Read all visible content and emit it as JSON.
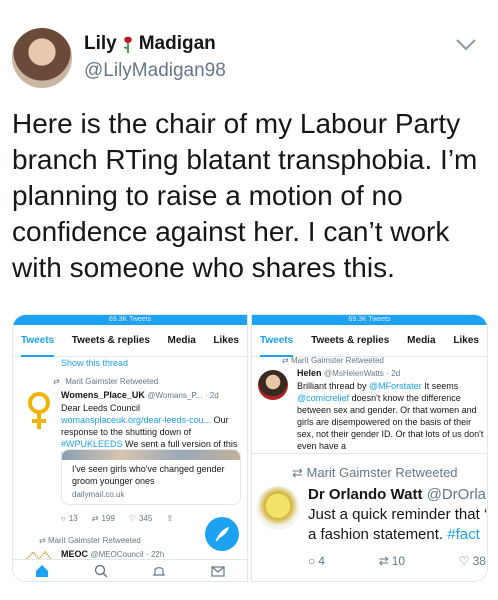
{
  "tweet": {
    "name_first": "Lily",
    "name_last": "Madigan",
    "handle": "@LilyMadigan98",
    "text": "Here is the chair of my Labour Party branch RTing blatant transphobia. I’m planning to raise a motion of no confidence against her. I can’t work with someone who shares this."
  },
  "left_panel": {
    "status": "69.3K Tweets",
    "tabs": [
      "Tweets",
      "Tweets & replies",
      "Media",
      "Likes"
    ],
    "show_thread": "Show this thread",
    "retweet_label": "Marit Gaimster Retweeted",
    "author_name": "Womens_Place_UK",
    "author_handle": "@Womans_P...",
    "time": "· 2d",
    "body_1": "Dear Leeds Council ",
    "body_link_1": "womansplaceuk.org/dear-leeds-cou...",
    "body_2": " Our response to the shutting down of ",
    "body_hashtag": "#WPUKLEEDS",
    "body_3": " We sent a full version of this letter to the Council",
    "card_title": "I've seen girls who've changed gender groom younger ones",
    "card_url": "dailymail.co.uk",
    "replies": "13",
    "retweets": "199",
    "likes": "345",
    "retweet_label_2": "Marit Gaimster Retweeted",
    "next_author_name": "MEOC",
    "next_author_handle": "@MEOCouncil",
    "next_time": "· 22h"
  },
  "right_panel": {
    "status": "69.3K Tweets",
    "tabs": [
      "Tweets",
      "Tweets & replies",
      "Media",
      "Likes"
    ],
    "retweet_label": "Marit Gaimster Retweeted",
    "helen_name": "Helen",
    "helen_handle": "@MsHelenWatts",
    "helen_time": "· 2d",
    "helen_1": "Brilliant thread by ",
    "helen_mention_1": "@MForstater",
    "helen_2": " It seems ",
    "helen_mention_2": "@comicrelief",
    "helen_3": " doesn't know the difference between sex and gender. Or that women and girls are disempowered on the basis of their sex, not their gender ID. Or that lots of us don't even have a",
    "retweet_label_2": "Marit Gaimster Retweeted",
    "orlando_name": "Dr Orlando Watt",
    "orlando_handle": "@DrOrland",
    "orlando_line1": "Just a quick reminder that ‘r",
    "orlando_line2": "a fashion statement. ",
    "orlando_hashtag": "#fact",
    "replies": "4",
    "retweets": "10",
    "likes": "38"
  },
  "colors": {
    "accent": "#1da1f2",
    "muted": "#657786",
    "text": "#14171a"
  }
}
